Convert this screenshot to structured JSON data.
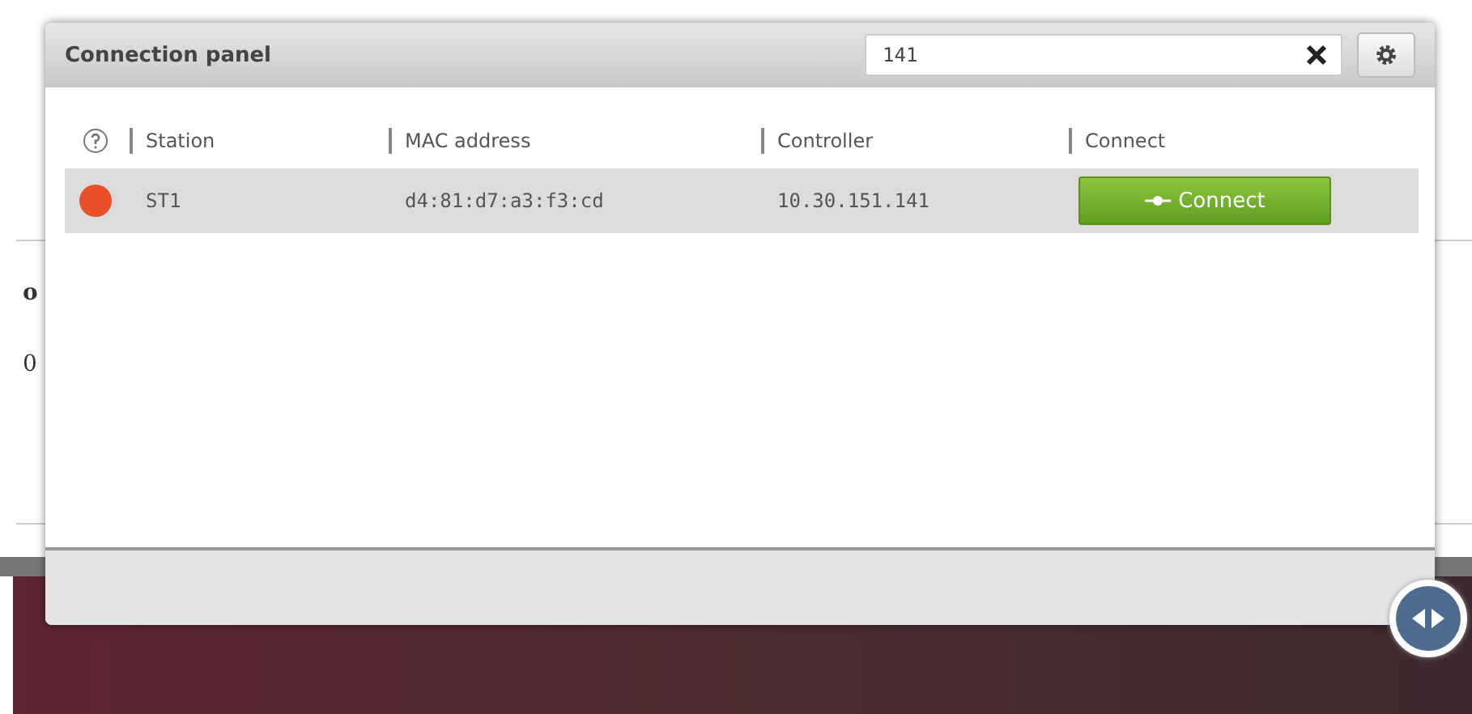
{
  "background": {
    "heading_fragment": "o",
    "value_fragment": "0"
  },
  "panel": {
    "title": "Connection panel",
    "search": {
      "value": "141"
    },
    "table": {
      "columns": [
        "Station",
        "MAC address",
        "Controller",
        "Connect"
      ],
      "rows": [
        {
          "color": "#e8502a",
          "station": "ST1",
          "mac": "d4:81:d7:a3:f3:cd",
          "controller": "10.30.151.141",
          "action": "Connect",
          "selected": true
        }
      ]
    }
  }
}
